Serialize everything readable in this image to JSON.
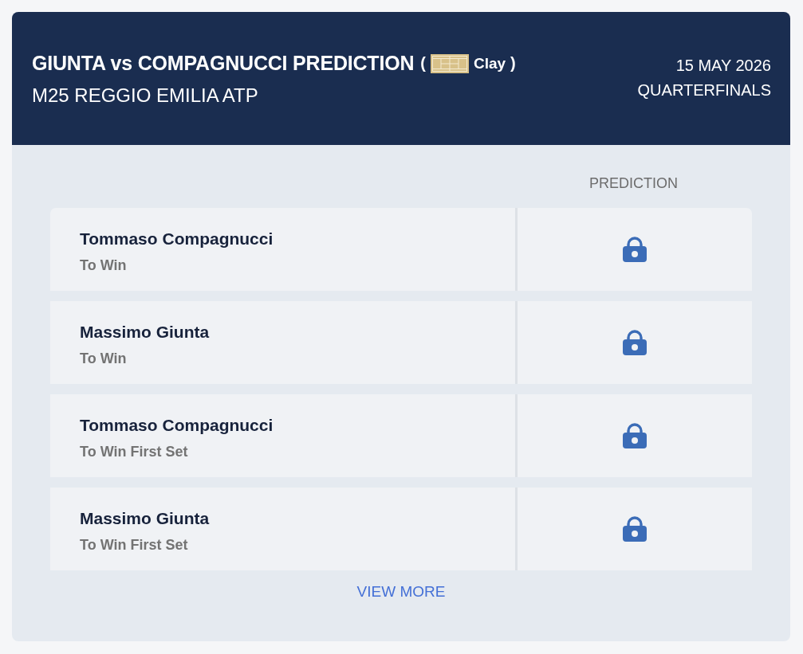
{
  "header": {
    "title": "GIUNTA vs COMPAGNUCCI PREDICTION",
    "surface": {
      "open_bracket": "(",
      "label": "Clay",
      "close_bracket": ")"
    },
    "tournament": "M25 REGGIO EMILIA ATP",
    "date": "15 MAY 2026",
    "round": "QUARTERFINALS"
  },
  "predictions": {
    "column_heading": "PREDICTION",
    "rows": [
      {
        "player": "Tommaso Compagnucci",
        "market": "To Win",
        "locked": true
      },
      {
        "player": "Massimo Giunta",
        "market": "To Win",
        "locked": true
      },
      {
        "player": "Tommaso Compagnucci",
        "market": "To Win First Set",
        "locked": true
      },
      {
        "player": "Massimo Giunta",
        "market": "To Win First Set",
        "locked": true
      }
    ]
  },
  "view_more": "VIEW MORE"
}
